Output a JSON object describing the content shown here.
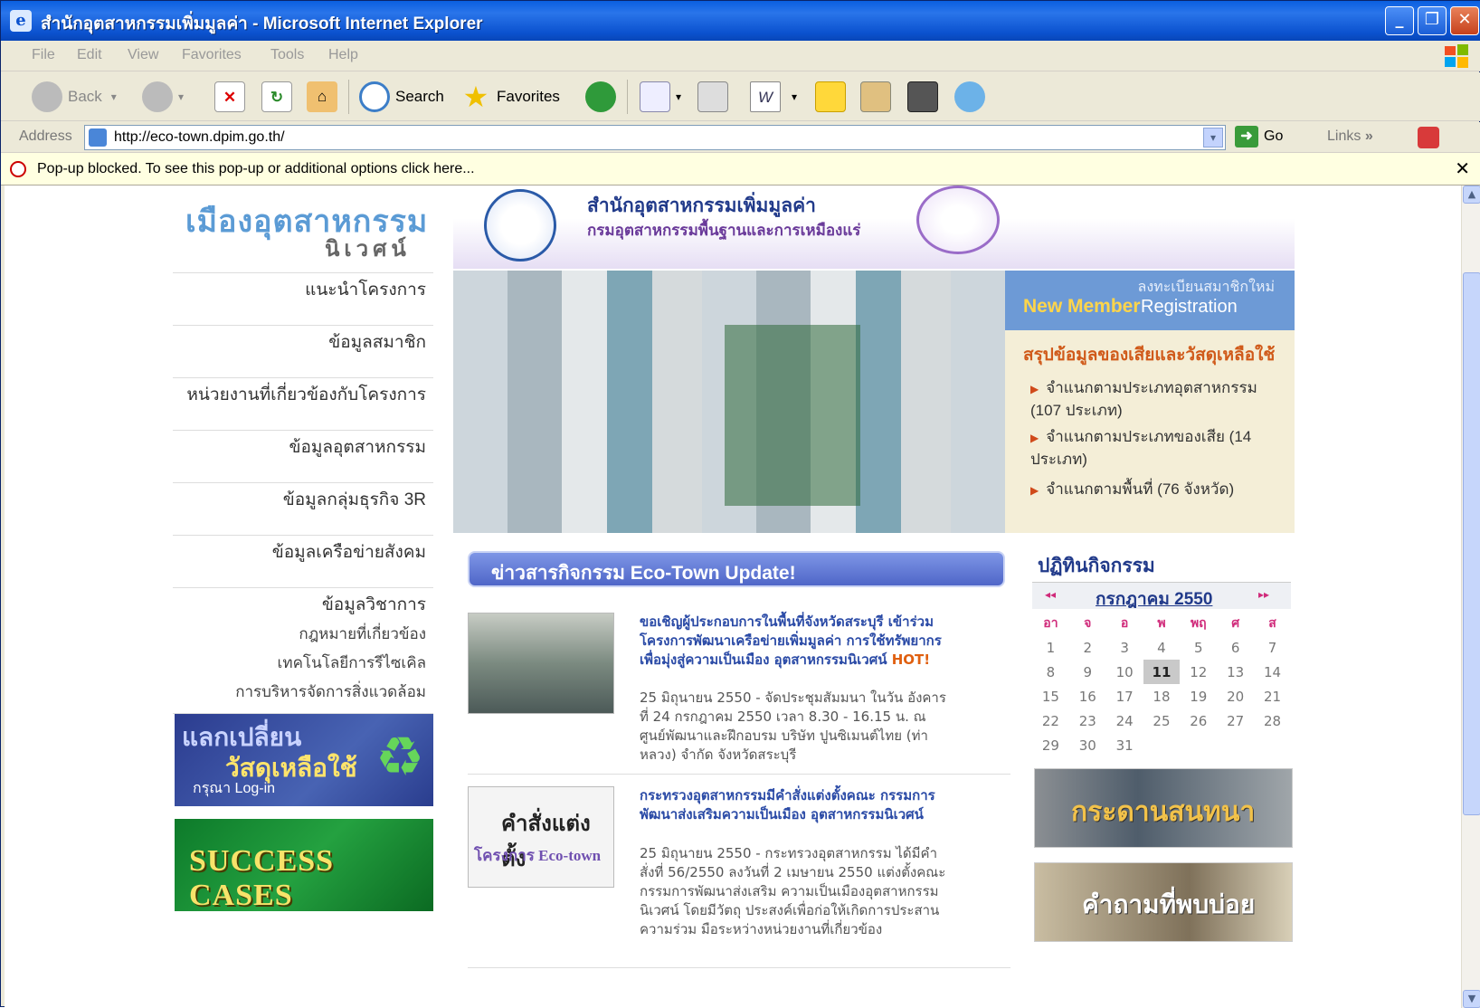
{
  "window": {
    "title": "สำนักอุตสาหกรรมเพิ่มมูลค่า - Microsoft Internet Explorer"
  },
  "menu": [
    "File",
    "Edit",
    "View",
    "Favorites",
    "Tools",
    "Help"
  ],
  "toolbar": {
    "back": "Back",
    "search": "Search",
    "favorites": "Favorites"
  },
  "address": {
    "label": "Address",
    "url": "http://eco-town.dpim.go.th/",
    "go": "Go",
    "links": "Links"
  },
  "popup": {
    "text": "Pop-up blocked. To see this pop-up or additional options click here..."
  },
  "site": {
    "logo_main": "เมืองอุตสาหกรรม",
    "logo_sub": "นิเวศน์",
    "header_title": "สำนักอุตสาหกรรมเพิ่มมูลค่า",
    "header_sub": "กรมอุตสาหกรรมพื้นฐานและการเหมืองแร่",
    "nav": [
      "แนะนำโครงการ",
      "ข้อมูลสมาชิก",
      "หน่วยงานที่เกี่ยวข้องกับโครงการ",
      "ข้อมูลอุตสาหกรรม",
      "ข้อมูลกลุ่มธุรกิจ 3R",
      "ข้อมูลเครือข่ายสังคม",
      "ข้อมูลวิชาการ"
    ],
    "subnav": [
      "กฎหมายที่เกี่ยวข้อง",
      "เทคโนโลยีการรีไซเคิล",
      "การบริหารจัดการสิ่งแวดล้อม"
    ],
    "banner_exchange": {
      "line1": "แลกเปลี่ยน",
      "line2": "วัสดุเหลือใช้",
      "line3": "กรุณา Log-in"
    },
    "banner_success": "SUCCESS CASES",
    "register": {
      "thai": "ลงทะเบียนสมาชิกใหม่",
      "new_member": "New Member",
      "registration": "Registration"
    },
    "summary_title": "สรุปข้อมูลของเสียและวัสดุเหลือใช้",
    "summary": [
      "จำแนกตามประเภทอุตสาหกรรม (107 ประเภท)",
      "จำแนกตามประเภทของเสีย (14 ประเภท)",
      "จำแนกตามพื้นที่ (76 จังหวัด)"
    ],
    "news_header": "ข่าวสารกิจกรรม  Eco-Town Update!",
    "news": [
      {
        "title": "ขอเชิญผู้ประกอบการในพื้นที่จังหวัดสระบุรี เข้าร่วมโครงการพัฒนาเครือข่ายเพิ่มมูลค่า การใช้ทรัพยากรเพื่อมุ่งสู่ความเป็นเมือง อุตสาหกรรมนิเวศน์",
        "hot": "HOT!",
        "text": "25 มิถุนายน 2550 - จัดประชุมสัมมนา ในวัน อังคารที่ 24 กรกฎาคม 2550 เวลา 8.30 - 16.15 น. ณ ศูนย์พัฒนาและฝึกอบรม บริษัท ปูนซิเมนต์ไทย (ท่าหลวง) จำกัด จังหวัดสระบุรี"
      },
      {
        "title": "กระทรวงอุตสาหกรรมมีคำสั่งแต่งตั้งคณะ กรรมการพัฒนาส่งเสริมความเป็นเมือง อุตสาหกรรมนิเวศน์",
        "thumb_a": "คำสั่งแต่งตั้ง",
        "thumb_b": "โครงการ Eco-town",
        "text": "25 มิถุนายน 2550 - กระทรวงอุตสาหกรรม ได้มีคำสั่งที่ 56/2550 ลงวันที่ 2 เมษายน 2550 แต่งตั้งคณะกรรมการพัฒนาส่งเสริม ความเป็นเมืองอุตสาหกรรมนิเวศน์ โดยมีวัตถุ ประสงค์เพื่อก่อให้เกิดการประสานความร่วม มือระหว่างหน่วยงานที่เกี่ยวข้อง"
      }
    ],
    "calendar": {
      "title": "ปฏิทินกิจกรรม",
      "prev": "◂◂",
      "next": "▸▸",
      "month": "กรกฎาคม 2550",
      "days": [
        "อา",
        "จ",
        "อ",
        "พ",
        "พฤ",
        "ศ",
        "ส"
      ],
      "weeks": [
        [
          "1",
          "2",
          "3",
          "4",
          "5",
          "6",
          "7"
        ],
        [
          "8",
          "9",
          "10",
          "11",
          "12",
          "13",
          "14"
        ],
        [
          "15",
          "16",
          "17",
          "18",
          "19",
          "20",
          "21"
        ],
        [
          "22",
          "23",
          "24",
          "25",
          "26",
          "27",
          "28"
        ],
        [
          "29",
          "30",
          "31",
          "",
          "",
          "",
          ""
        ]
      ],
      "today": "11"
    },
    "photo_talk": "กระดานสนทนา",
    "photo_faq": "คำถามที่พบบ่อย"
  }
}
